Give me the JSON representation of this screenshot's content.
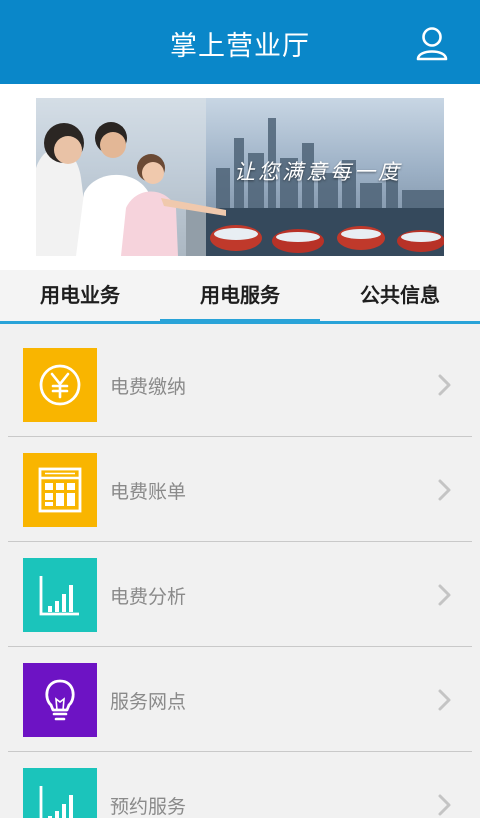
{
  "header": {
    "title": "掌上营业厅",
    "user_icon": "user-icon",
    "bg_color": "#0a87c9"
  },
  "banner": {
    "slogan": "让您满意每一度"
  },
  "tabs": [
    {
      "label": "用电业务",
      "active": false
    },
    {
      "label": "用电服务",
      "active": true
    },
    {
      "label": "公共信息",
      "active": false
    }
  ],
  "accent_color": "#29a3d8",
  "menu": {
    "items": [
      {
        "label": "电费缴纳",
        "icon": "yen-coin-icon",
        "color": "#f9b500"
      },
      {
        "label": "电费账单",
        "icon": "bill-table-icon",
        "color": "#f9b500"
      },
      {
        "label": "电费分析",
        "icon": "bar-chart-icon",
        "color": "#1bc4bb"
      },
      {
        "label": "服务网点",
        "icon": "light-bulb-icon",
        "color": "#6d13c4"
      },
      {
        "label": "预约服务",
        "icon": "bar-chart-icon",
        "color": "#1bc4bb"
      }
    ]
  }
}
